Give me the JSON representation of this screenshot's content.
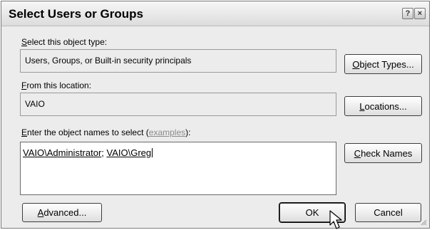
{
  "window": {
    "title": "Select Users or Groups",
    "help_glyph": "?",
    "close_glyph": "×"
  },
  "object_type": {
    "label_accel": "S",
    "label_rest": "elect this object type:",
    "value": "Users, Groups, or Built-in security principals",
    "button_accel": "O",
    "button_rest": "bject Types..."
  },
  "location": {
    "label_accel": "F",
    "label_rest": "rom this location:",
    "value": "VAIO",
    "button_accel": "L",
    "button_rest": "ocations..."
  },
  "names": {
    "label_accel": "E",
    "label_rest": "nter the object names to select (",
    "examples_link": "examples",
    "label_end": "):",
    "entry1": "VAIO\\Administrator",
    "separator": "; ",
    "entry2": "VAIO\\Greg",
    "check_accel": "C",
    "check_rest": "heck Names"
  },
  "footer": {
    "advanced_accel": "A",
    "advanced_rest": "dvanced...",
    "ok_label": "OK",
    "cancel_label": "Cancel"
  },
  "icons": {
    "cursor": "mouse-pointer-icon",
    "resize": "resize-grip-icon"
  }
}
